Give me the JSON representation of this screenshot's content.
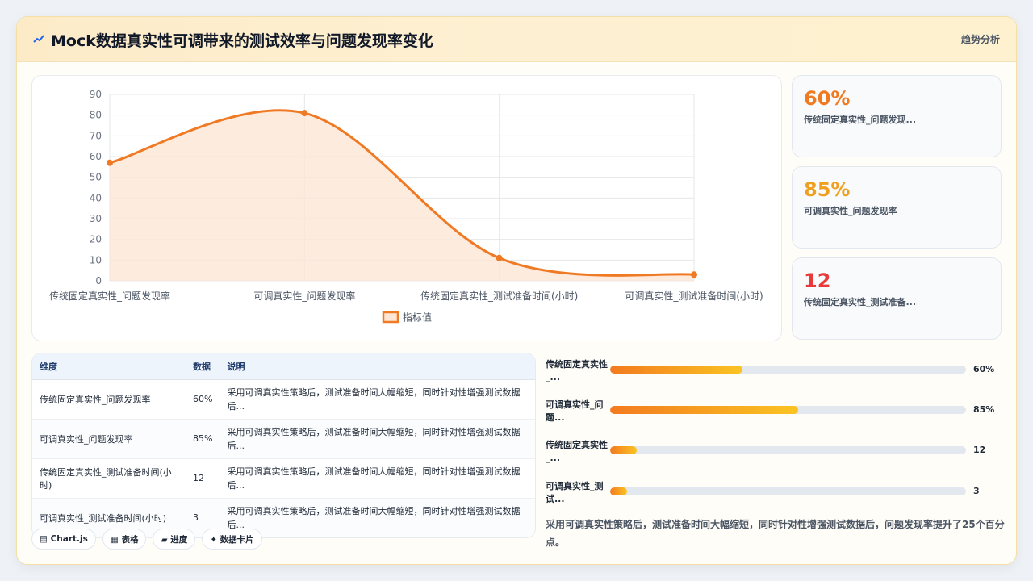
{
  "header": {
    "title": "Mock数据真实性可调带来的测试效率与问题发现率变化",
    "badge": "趋势分析",
    "icon": "trend-icon"
  },
  "chart_data": {
    "type": "line",
    "categories": [
      "传统固定真实性_问题发现率",
      "可调真实性_问题发现率",
      "传统固定真实性_测试准备时间(小时)",
      "可调真实性_测试准备时间(小时)"
    ],
    "series": [
      {
        "name": "指标值",
        "values": [
          57,
          81,
          11,
          3
        ]
      }
    ],
    "ylim": [
      0,
      90
    ],
    "yticks": [
      0,
      10,
      20,
      30,
      40,
      50,
      60,
      70,
      80,
      90
    ],
    "grid": true,
    "legend": "bottom",
    "line_color": "#f07a24",
    "fill_color": "#fde6d6"
  },
  "kpis": [
    {
      "value": "60%",
      "label": "传统固定真实性_问题发现...",
      "color": "#f07a1f"
    },
    {
      "value": "85%",
      "label": "可调真实性_问题发现率",
      "color": "#f0a020"
    },
    {
      "value": "12",
      "label": "传统固定真实性_测试准备...",
      "color": "#e83a3a"
    }
  ],
  "table": {
    "headers": [
      "维度",
      "数据",
      "说明"
    ],
    "rows": [
      {
        "dim": "传统固定真实性_问题发现率",
        "val": "60%",
        "desc": "采用可调真实性策略后，测试准备时间大幅缩短，同时针对性增强测试数据后..."
      },
      {
        "dim": "可调真实性_问题发现率",
        "val": "85%",
        "desc": "采用可调真实性策略后，测试准备时间大幅缩短，同时针对性增强测试数据后..."
      },
      {
        "dim": "传统固定真实性_测试准备时间(小时)",
        "val": "12",
        "desc": "采用可调真实性策略后，测试准备时间大幅缩短，同时针对性增强测试数据后..."
      },
      {
        "dim": "可调真实性_测试准备时间(小时)",
        "val": "3",
        "desc": "采用可调真实性策略后，测试准备时间大幅缩短，同时针对性增强测试数据后..."
      }
    ]
  },
  "tags": [
    {
      "label": "▤ Chart.js"
    },
    {
      "label": "▦ 表格"
    },
    {
      "label": "▰ 进度"
    },
    {
      "label": "✦ 数据卡片"
    }
  ],
  "progress": [
    {
      "label": "传统固定真实性_...",
      "value": "60%",
      "fraction": 0.373
    },
    {
      "label": "可调真实性_问题...",
      "value": "85%",
      "fraction": 0.528
    },
    {
      "label": "传统固定真实性_...",
      "value": "12",
      "fraction": 0.075
    },
    {
      "label": "可调真实性_测试...",
      "value": "3",
      "fraction": 0.048
    }
  ],
  "summary": "采用可调真实性策略后，测试准备时间大幅缩短，同时针对性增强测试数据后，问题发现率提升了25个百分点。"
}
